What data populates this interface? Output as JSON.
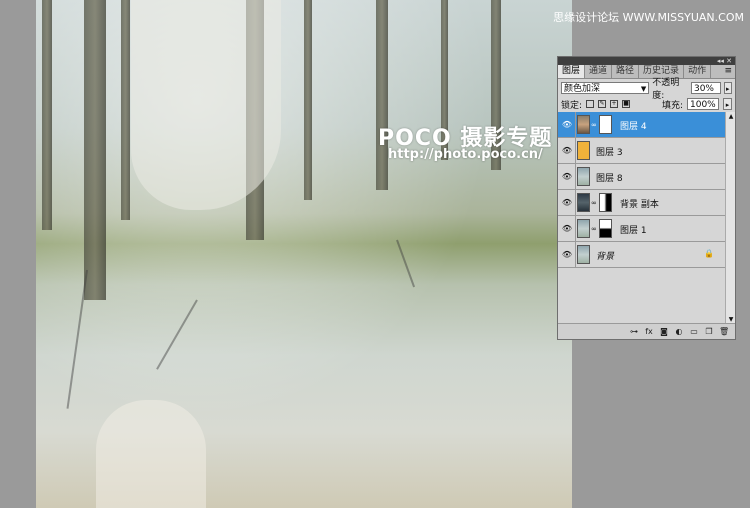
{
  "watermark": {
    "logo": "POCO 摄影专题",
    "url": "http://photo.poco.cn/",
    "site": "思缘设计论坛 WWW.MISSYUAN.COM"
  },
  "panel": {
    "tabs": [
      "图层",
      "通道",
      "路径",
      "历史记录",
      "动作"
    ],
    "active_tab": "图层",
    "blend_mode": "颜色加深",
    "opacity_label": "不透明度:",
    "opacity_value": "30%",
    "lock_label": "锁定:",
    "fill_label": "填充:",
    "fill_value": "100%",
    "layers": [
      {
        "name": "图层 4",
        "selected": true,
        "thumb": "photo-portrait",
        "mask": true
      },
      {
        "name": "图层 3",
        "selected": false,
        "thumb": "orange-fill",
        "mask": false
      },
      {
        "name": "图层 8",
        "selected": false,
        "thumb": "forest",
        "mask": false
      },
      {
        "name": "背景 副本",
        "selected": false,
        "thumb": "dark-forest",
        "mask": true
      },
      {
        "name": "图层 1",
        "selected": false,
        "thumb": "forest",
        "mask": true
      },
      {
        "name": "背景",
        "selected": false,
        "thumb": "forest",
        "mask": false,
        "locked": true
      }
    ],
    "footer_icons": [
      "link-icon",
      "fx-icon",
      "mask-icon",
      "adjustment-icon",
      "folder-icon",
      "new-layer-icon",
      "trash-icon"
    ],
    "icons": {
      "visibility": "eye-icon",
      "chain": "chain-icon",
      "lock": "lock-icon",
      "panel_menu": "panel-menu-icon"
    }
  },
  "colors": {
    "selected_layer": "#3a8fd8",
    "panel_bg": "#d6d6d6",
    "workspace": "#9a9a9a"
  }
}
